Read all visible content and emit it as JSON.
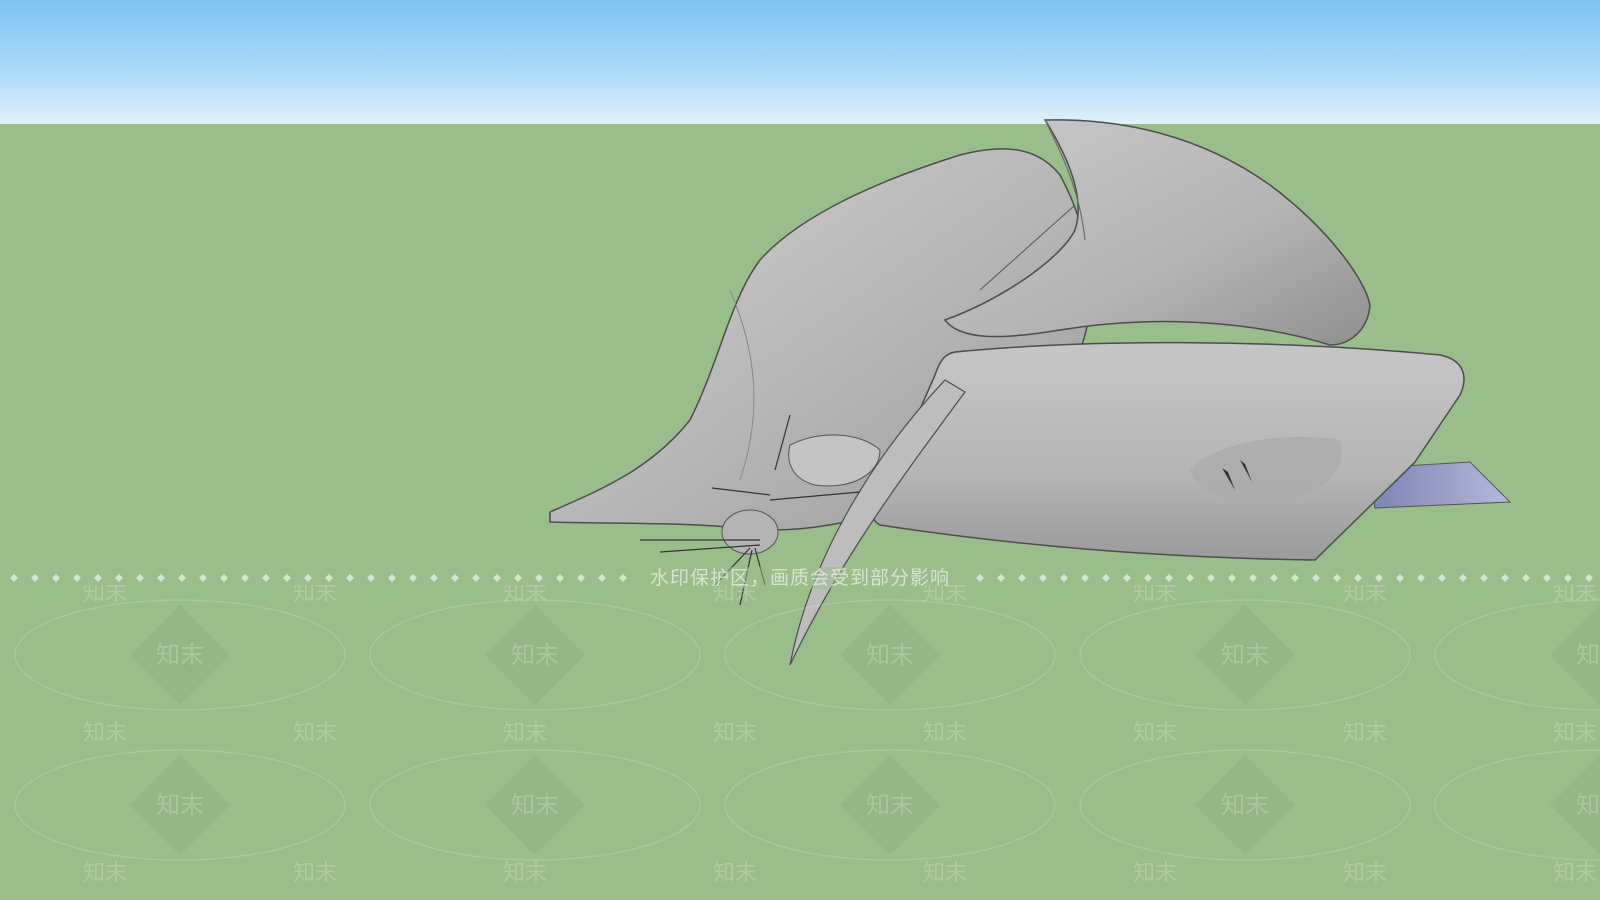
{
  "scene": {
    "sky_color_top": "#7ec4f4",
    "sky_color_bottom": "#dff1fb",
    "ground_color": "#99bd8b",
    "model_color": "#b9b9b9",
    "model_edge_color": "#555555",
    "accent_blade_color": "#9a9fc9"
  },
  "watermark": {
    "banner_text": "水印保护区，画质会受到部分影响",
    "brand_text": "知末"
  }
}
